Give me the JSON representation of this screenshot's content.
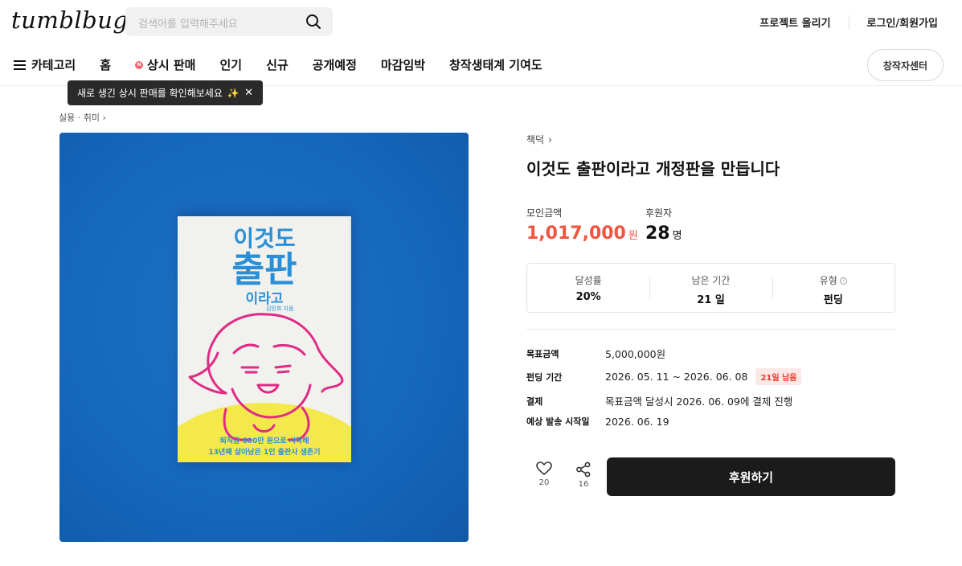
{
  "header": {
    "logo": "tumblbug",
    "search_placeholder": "검색어를 입력해주세요",
    "upload_project": "프로젝트 올리기",
    "login": "로그인/회원가입"
  },
  "nav": {
    "category": "카테고리",
    "items": [
      "홈",
      "상시 판매",
      "인기",
      "신규",
      "공개예정",
      "마감임박",
      "창작생태계 기여도"
    ],
    "badge": "N",
    "creator_center": "창작자센터"
  },
  "tooltip": {
    "text": "새로 생긴 상시 판매를 확인해보세요",
    "sparkle": "✨",
    "close": "✕"
  },
  "breadcrumb": "실용 · 취미",
  "cover": {
    "title_line1": "이것도",
    "title_line2": "출판",
    "title_line3": "이라고",
    "author": "김민희 지음",
    "subtitle_line1": "퇴직금 600만 원으로 시작해",
    "subtitle_line2": "13년째 살아남은 1인 출판사 생존기"
  },
  "project": {
    "creator": "책덕",
    "title": "이것도 출판이라고 개정판을 만듭니다",
    "raised_label": "모인금액",
    "raised_amount": "1,017,000",
    "raised_unit": "원",
    "backers_label": "후원자",
    "backers_count": "28",
    "backers_unit": "명"
  },
  "stats": [
    {
      "label": "달성률",
      "value": "20%"
    },
    {
      "label": "남은 기간",
      "value": "21 일"
    },
    {
      "label": "유형",
      "value": "펀딩",
      "info": "i"
    }
  ],
  "details": {
    "goal_label": "목표금액",
    "goal_value": "5,000,000원",
    "period_label": "펀딩 기간",
    "period_value": "2026. 05. 11 ~ 2026. 06. 08",
    "period_badge": "21일 남음",
    "payment_label": "결제",
    "payment_value": "목표금액 달성시 2026. 06. 09에 결제 진행",
    "delivery_label": "예상 발송 시작일",
    "delivery_value": "2026. 06. 19"
  },
  "actions": {
    "like_count": "20",
    "share_count": "16",
    "back_button": "후원하기"
  },
  "colors": {
    "accent_red": "#f1543f",
    "cover_blue": "#1566bd",
    "cover_text_blue": "#2a8fd6",
    "cover_yellow": "#f4e94a",
    "button_dark": "#1b1b1b"
  }
}
